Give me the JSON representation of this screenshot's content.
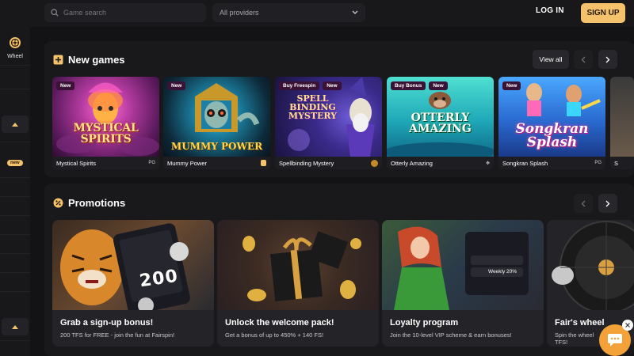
{
  "topbar": {
    "search_placeholder": "Game search",
    "providers_label": "All providers",
    "login_label": "LOG IN",
    "signup_label": "SIGN UP"
  },
  "sidebar": {
    "wheel_label": "Wheel",
    "new_badge": "new"
  },
  "new_games": {
    "title": "New games",
    "view_all": "View all",
    "games": [
      {
        "name": "Mystical Spirits",
        "tags": [
          "New"
        ],
        "logo": "MYSTICAL SPIRITS"
      },
      {
        "name": "Mummy Power",
        "tags": [
          "New"
        ],
        "logo": "MUMMY POWER"
      },
      {
        "name": "Spellbinding Mystery",
        "tags": [
          "Buy Freespin",
          "New"
        ],
        "logo": "SPELL BINDING MYSTERY"
      },
      {
        "name": "Otterly Amazing",
        "tags": [
          "Buy Bonus",
          "New"
        ],
        "logo": "OTTERLY AMAZING"
      },
      {
        "name": "Songkran Splash",
        "tags": [
          "New"
        ],
        "logo": "Songkran Splash"
      },
      {
        "name": "S",
        "tags": [],
        "logo": ""
      }
    ]
  },
  "promotions": {
    "title": "Promotions",
    "cards": [
      {
        "title": "Grab a sign-up bonus!",
        "desc": "200 TFS for FREE - join the fun at Fairspin!",
        "art_text": "200"
      },
      {
        "title": "Unlock the welcome pack!",
        "desc": "Get a bonus of up to 450% + 140 FS!",
        "art_text": ""
      },
      {
        "title": "Loyalty program",
        "desc": "Join the 10-level VIP scheme & earn bonuses!",
        "art_text": "Weekly 20%"
      },
      {
        "title": "Fair's wheel",
        "desc": "Spin the wheel",
        "desc2": "TFS!",
        "art_text": ""
      }
    ]
  },
  "colors": {
    "accent": "#f3c26b",
    "background": "#131315",
    "panel": "#19191c",
    "tag": "#3a1236",
    "chat": "#f3a23a"
  }
}
